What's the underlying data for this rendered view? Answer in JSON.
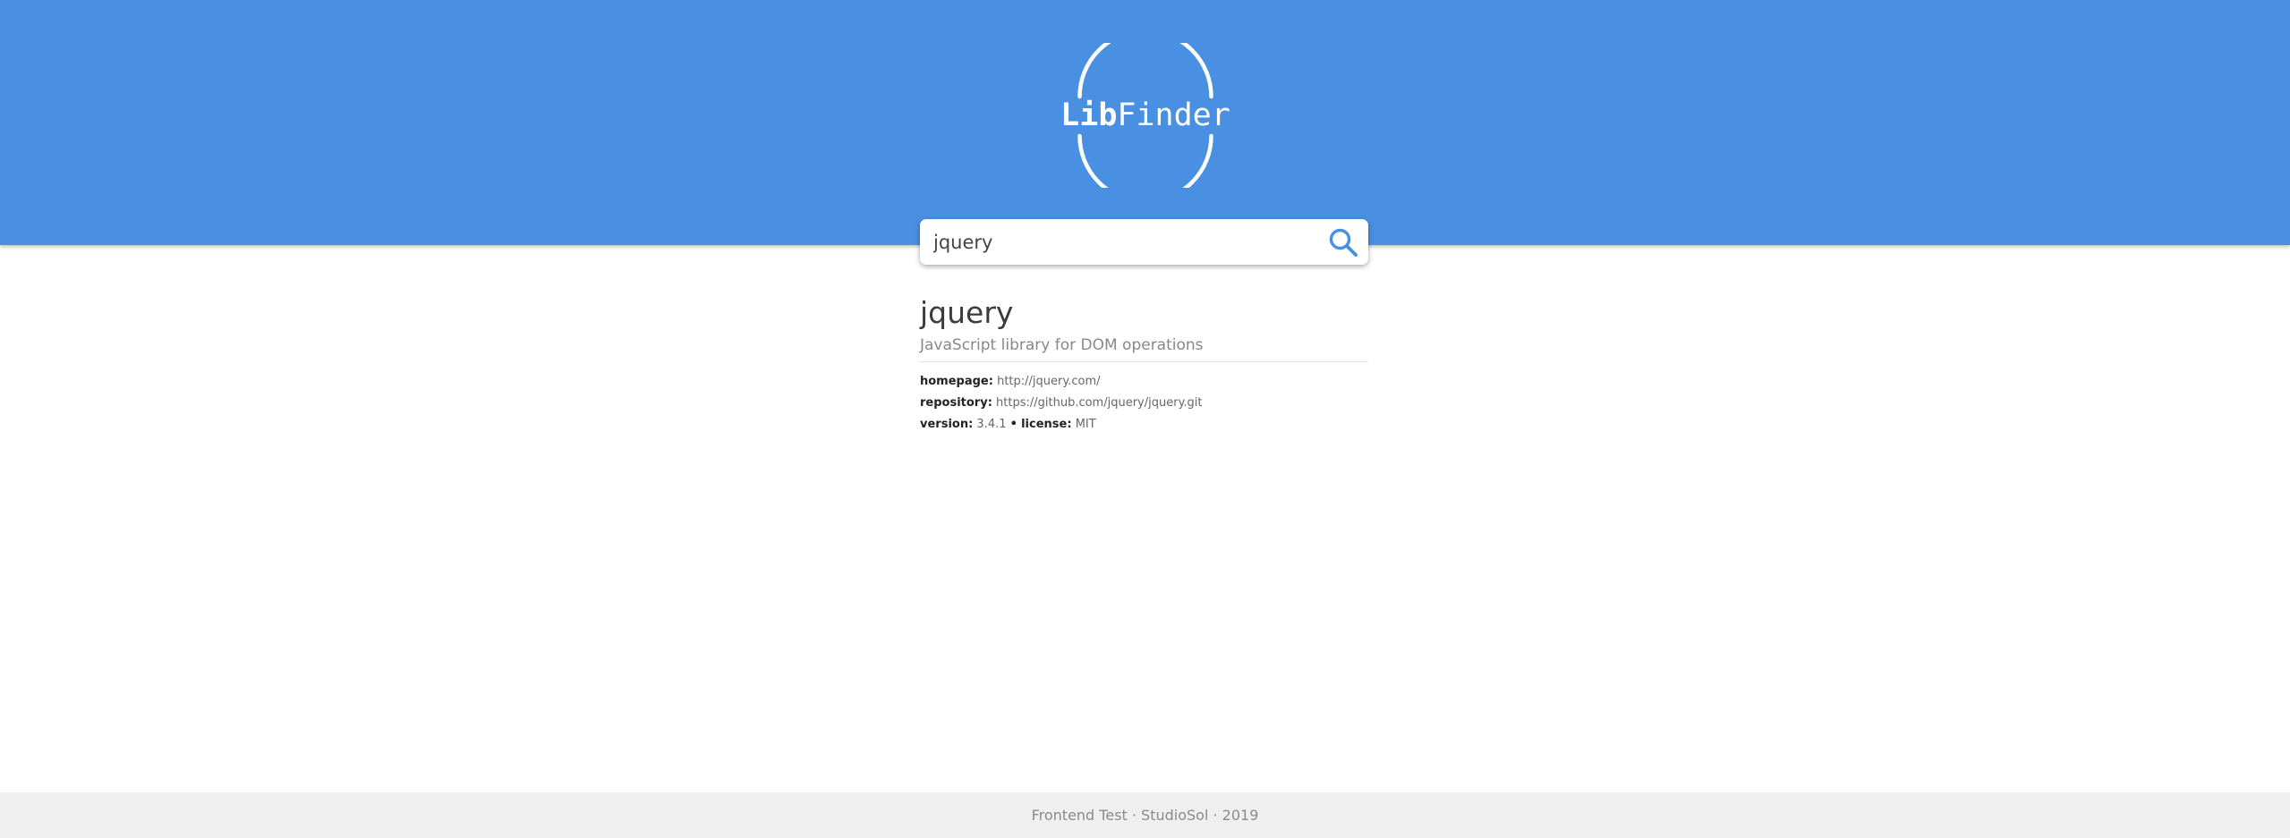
{
  "brand": {
    "logo_bold": "Lib",
    "logo_light": "Finder",
    "header_color": "#4a90e2"
  },
  "search": {
    "value": "jquery",
    "icon": "search-icon",
    "icon_color": "#4a90e2"
  },
  "result": {
    "title": "jquery",
    "description": "JavaScript library for DOM operations",
    "homepage_label": "homepage:",
    "homepage_value": "http://jquery.com/",
    "repository_label": "repository:",
    "repository_value": "https://github.com/jquery/jquery.git",
    "version_label": "version:",
    "version_value": "3.4.1",
    "separator": "•",
    "license_label": "license:",
    "license_value": "MIT"
  },
  "footer": {
    "text": "Frontend Test · StudioSol · 2019"
  }
}
